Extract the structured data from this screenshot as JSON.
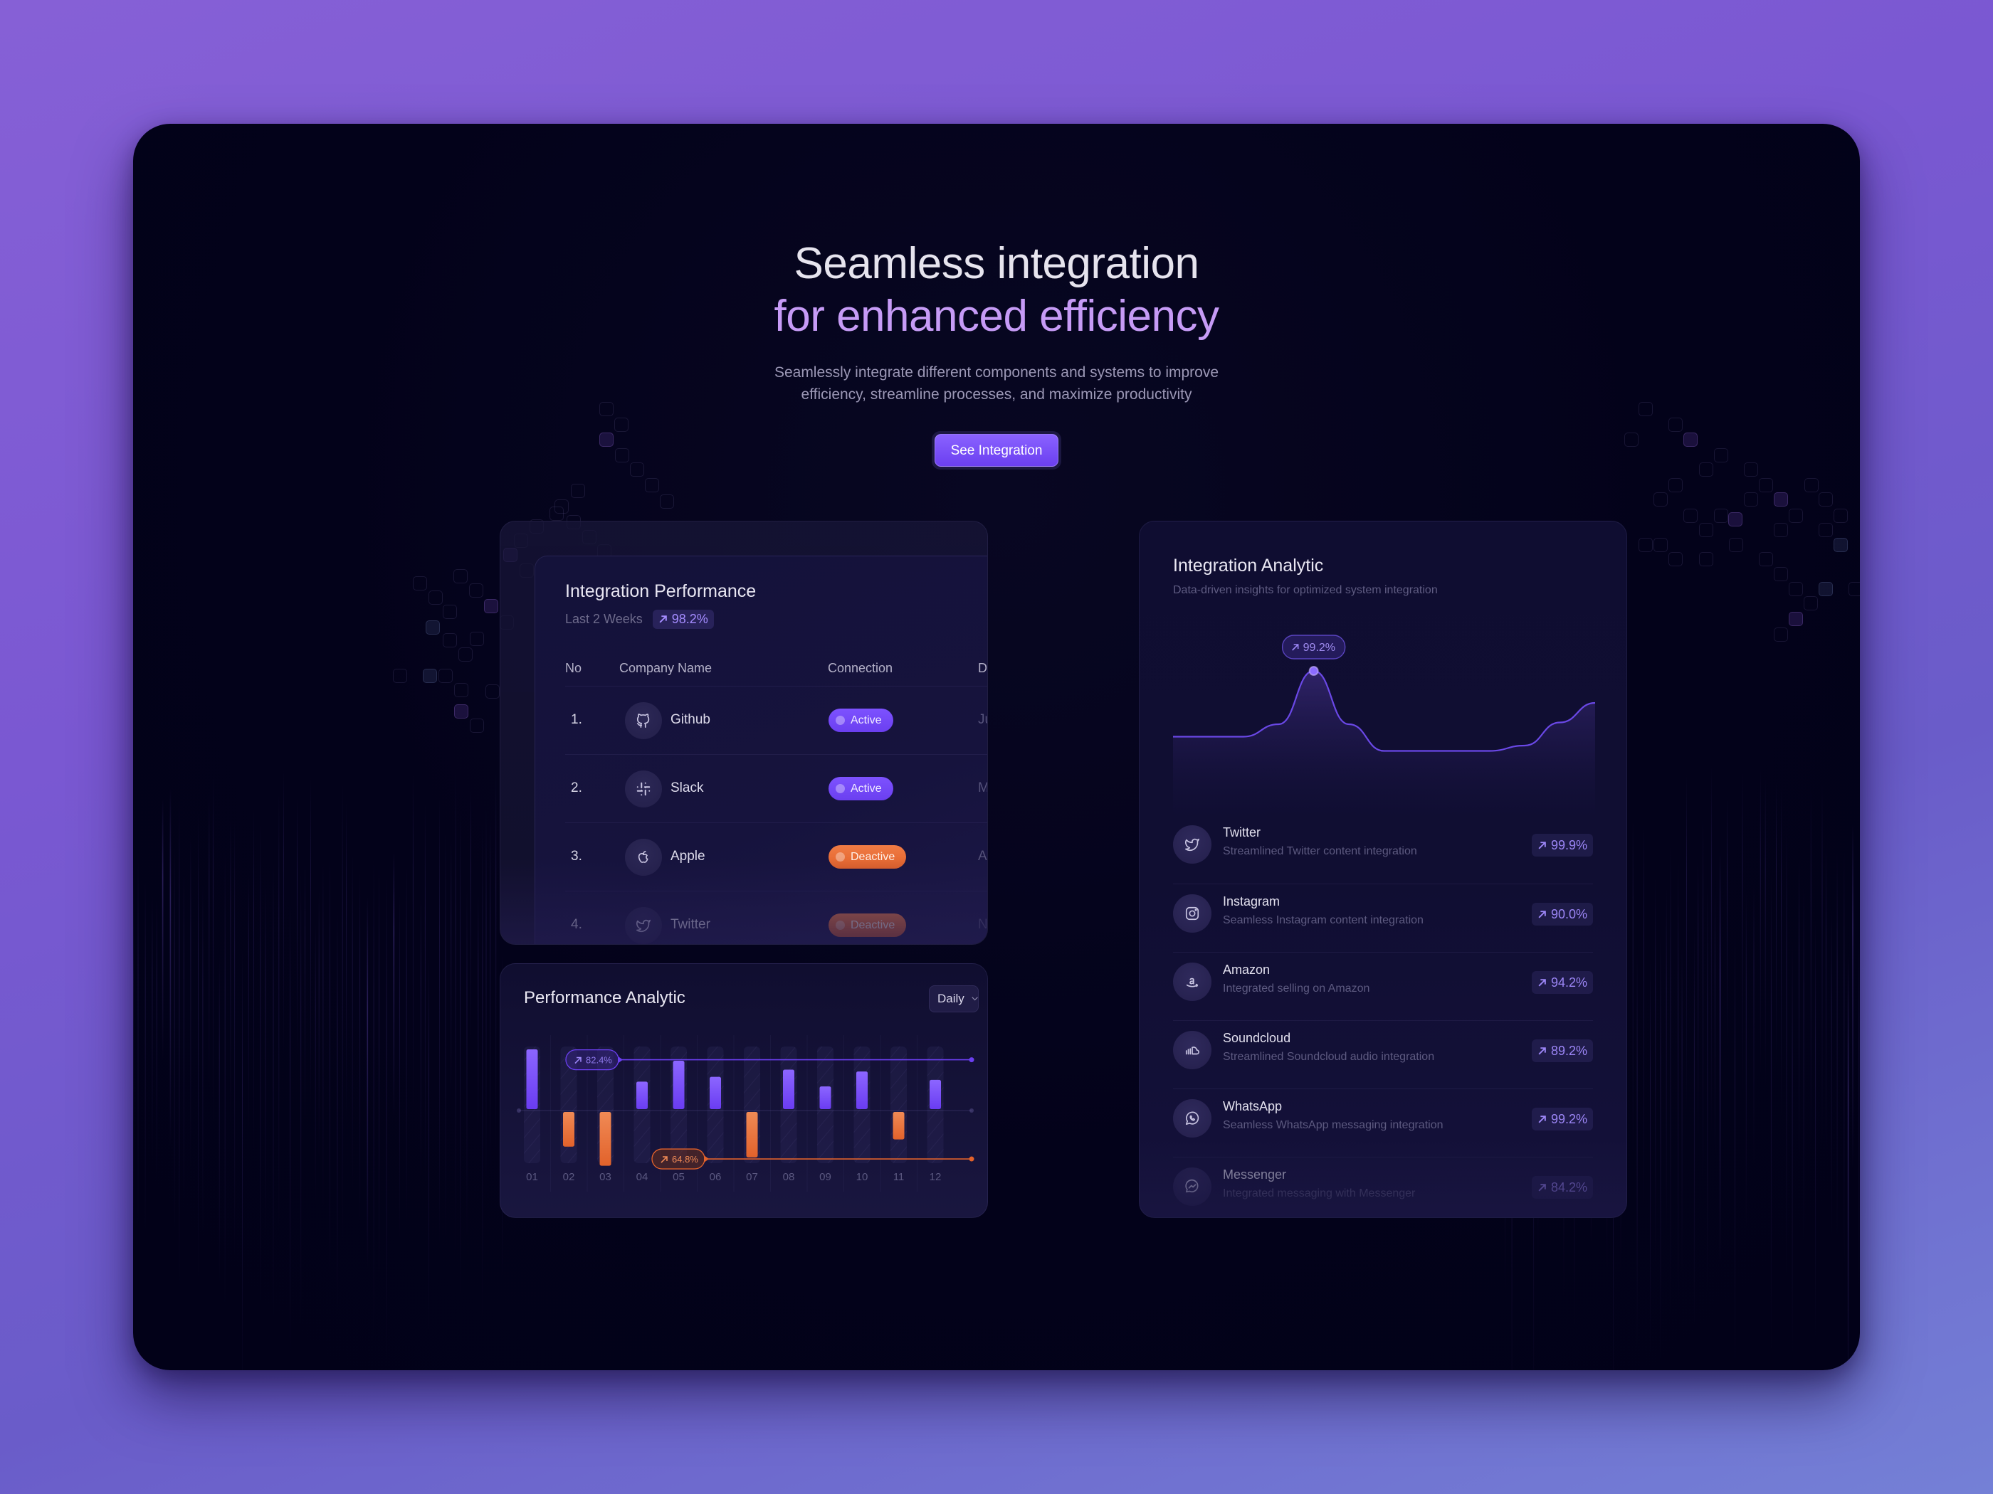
{
  "hero": {
    "title_line1": "Seamless integration",
    "title_line2": "for enhanced efficiency",
    "subtitle_line1": "Seamlessly integrate different components and systems to improve",
    "subtitle_line2": "efficiency, streamline processes, and maximize productivity",
    "cta_label": "See Integration"
  },
  "colors": {
    "accent_purple": "#6b3ff0",
    "accent_orange": "#e2622b",
    "title_purple": "#c69bf6",
    "frame_bg": "#03021a",
    "page_bg": "#7a58d2"
  },
  "integration_performance": {
    "title": "Integration Performance",
    "period": "Last 2 Weeks",
    "change": "98.2%",
    "change_icon": "arrow-up-right-icon",
    "columns": [
      "No",
      "Company Name",
      "Connection",
      "Da"
    ],
    "rows": [
      {
        "no": "1.",
        "company": "Github",
        "icon": "github-icon",
        "connection": "Active",
        "status": "active",
        "date": "Ju"
      },
      {
        "no": "2.",
        "company": "Slack",
        "icon": "slack-icon",
        "connection": "Active",
        "status": "active",
        "date": "M"
      },
      {
        "no": "3.",
        "company": "Apple",
        "icon": "apple-icon",
        "connection": "Deactive",
        "status": "deactive",
        "date": "Ap"
      },
      {
        "no": "4.",
        "company": "Twitter",
        "icon": "twitter-icon",
        "connection": "Deactive",
        "status": "deactive",
        "date": "No"
      }
    ]
  },
  "performance_analytic": {
    "title": "Performance Analytic",
    "period_select": "Daily"
  },
  "integration_analytic": {
    "title": "Integration Analytic",
    "subtitle": "Data-driven insights for optimized system integration",
    "items": [
      {
        "name": "Twitter",
        "desc": "Streamlined Twitter content integration",
        "value": "99.9%",
        "icon": "twitter-icon"
      },
      {
        "name": "Instagram",
        "desc": "Seamless Instagram content integration",
        "value": "90.0%",
        "icon": "instagram-icon"
      },
      {
        "name": "Amazon",
        "desc": "Integrated selling on Amazon",
        "value": "94.2%",
        "icon": "amazon-icon"
      },
      {
        "name": "Soundcloud",
        "desc": "Streamlined Soundcloud audio integration",
        "value": "89.2%",
        "icon": "soundcloud-icon"
      },
      {
        "name": "WhatsApp",
        "desc": "Seamless WhatsApp messaging integration",
        "value": "99.2%",
        "icon": "whatsapp-icon"
      },
      {
        "name": "Messenger",
        "desc": "Integrated messaging with Messenger",
        "value": "84.2%",
        "icon": "messenger-icon"
      }
    ]
  },
  "chart_data": [
    {
      "type": "bar",
      "title": "Performance Analytic",
      "categories": [
        "01",
        "02",
        "03",
        "04",
        "05",
        "06",
        "07",
        "08",
        "09",
        "10",
        "11",
        "12"
      ],
      "series": [
        {
          "name": "positive",
          "color": "#6b3ff0",
          "values": [
            100,
            0,
            0,
            46,
            81,
            54,
            0,
            66,
            38,
            63,
            0,
            49
          ]
        },
        {
          "name": "negative",
          "color": "#e2622b",
          "values": [
            0,
            -58,
            -90,
            0,
            0,
            0,
            -76,
            0,
            0,
            0,
            -46,
            0
          ]
        }
      ],
      "ylim": [
        -125,
        125
      ],
      "reference_lines": [
        {
          "label": "82.4%",
          "value": 85,
          "color": "#6b3ff0"
        },
        {
          "label": "64.8%",
          "value": -81,
          "color": "#e2622b"
        }
      ],
      "xlabel": "",
      "ylabel": "",
      "grid": false,
      "legend": "none"
    },
    {
      "type": "area",
      "title": "Integration Analytic",
      "x": [
        0,
        1,
        2,
        3,
        4,
        5,
        6,
        7,
        8,
        9,
        10,
        11,
        12
      ],
      "values": [
        55,
        55,
        55,
        62,
        92,
        62,
        47,
        47,
        47,
        47,
        50,
        63,
        74
      ],
      "ylim": [
        0,
        100
      ],
      "annotation": {
        "label": "99.2%",
        "x": 4
      },
      "xlabel": "",
      "ylabel": "",
      "grid": false,
      "legend": "none"
    }
  ]
}
